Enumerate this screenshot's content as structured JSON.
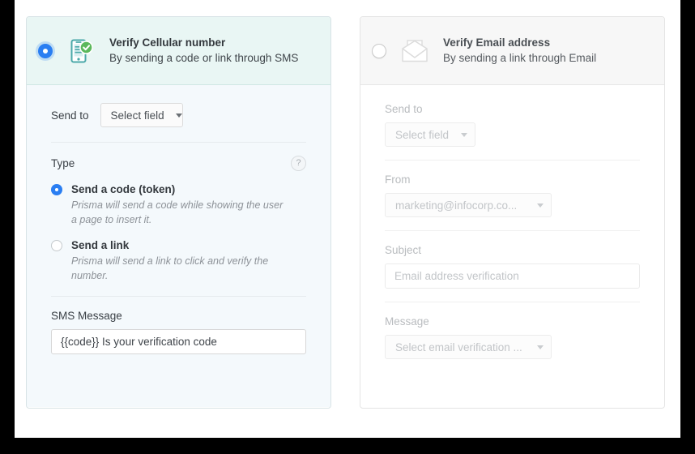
{
  "panels": {
    "cellular": {
      "selected": true,
      "radio_name": "verify-cellular-radio",
      "icon": "mobile-phone-check-icon",
      "title": "Verify Cellular number",
      "subtitle": "By sending a code or link through SMS",
      "send_to": {
        "label": "Send to",
        "value": "Select field"
      },
      "type": {
        "label": "Type",
        "help_glyph": "?",
        "options": [
          {
            "selected": true,
            "title": "Send a code (token)",
            "description": "Prisma will send a code while showing the user a page to insert it."
          },
          {
            "selected": false,
            "title": "Send a link",
            "description": "Prisma will send a link to click and verify the number."
          }
        ]
      },
      "sms_message": {
        "label": "SMS Message",
        "value": "{{code}} Is your verification code"
      }
    },
    "email": {
      "selected": false,
      "radio_name": "verify-email-radio",
      "icon": "open-envelope-icon",
      "title": "Verify Email address",
      "subtitle": "By sending a link through Email",
      "send_to": {
        "label": "Send to",
        "value": "Select field"
      },
      "from": {
        "label": "From",
        "value": "marketing@infocorp.co..."
      },
      "subject": {
        "label": "Subject",
        "value": "Email address verification"
      },
      "message": {
        "label": "Message",
        "value": "Select email verification ..."
      }
    }
  },
  "colors": {
    "accent_blue": "#2a7ef2",
    "cellular_header_bg": "#e9f6f4",
    "cellular_body_bg": "#f4f9fc",
    "email_header_bg": "#f7f7f7",
    "phone_icon_teal": "#4aa8a8",
    "check_badge_green": "#5cb85c"
  }
}
